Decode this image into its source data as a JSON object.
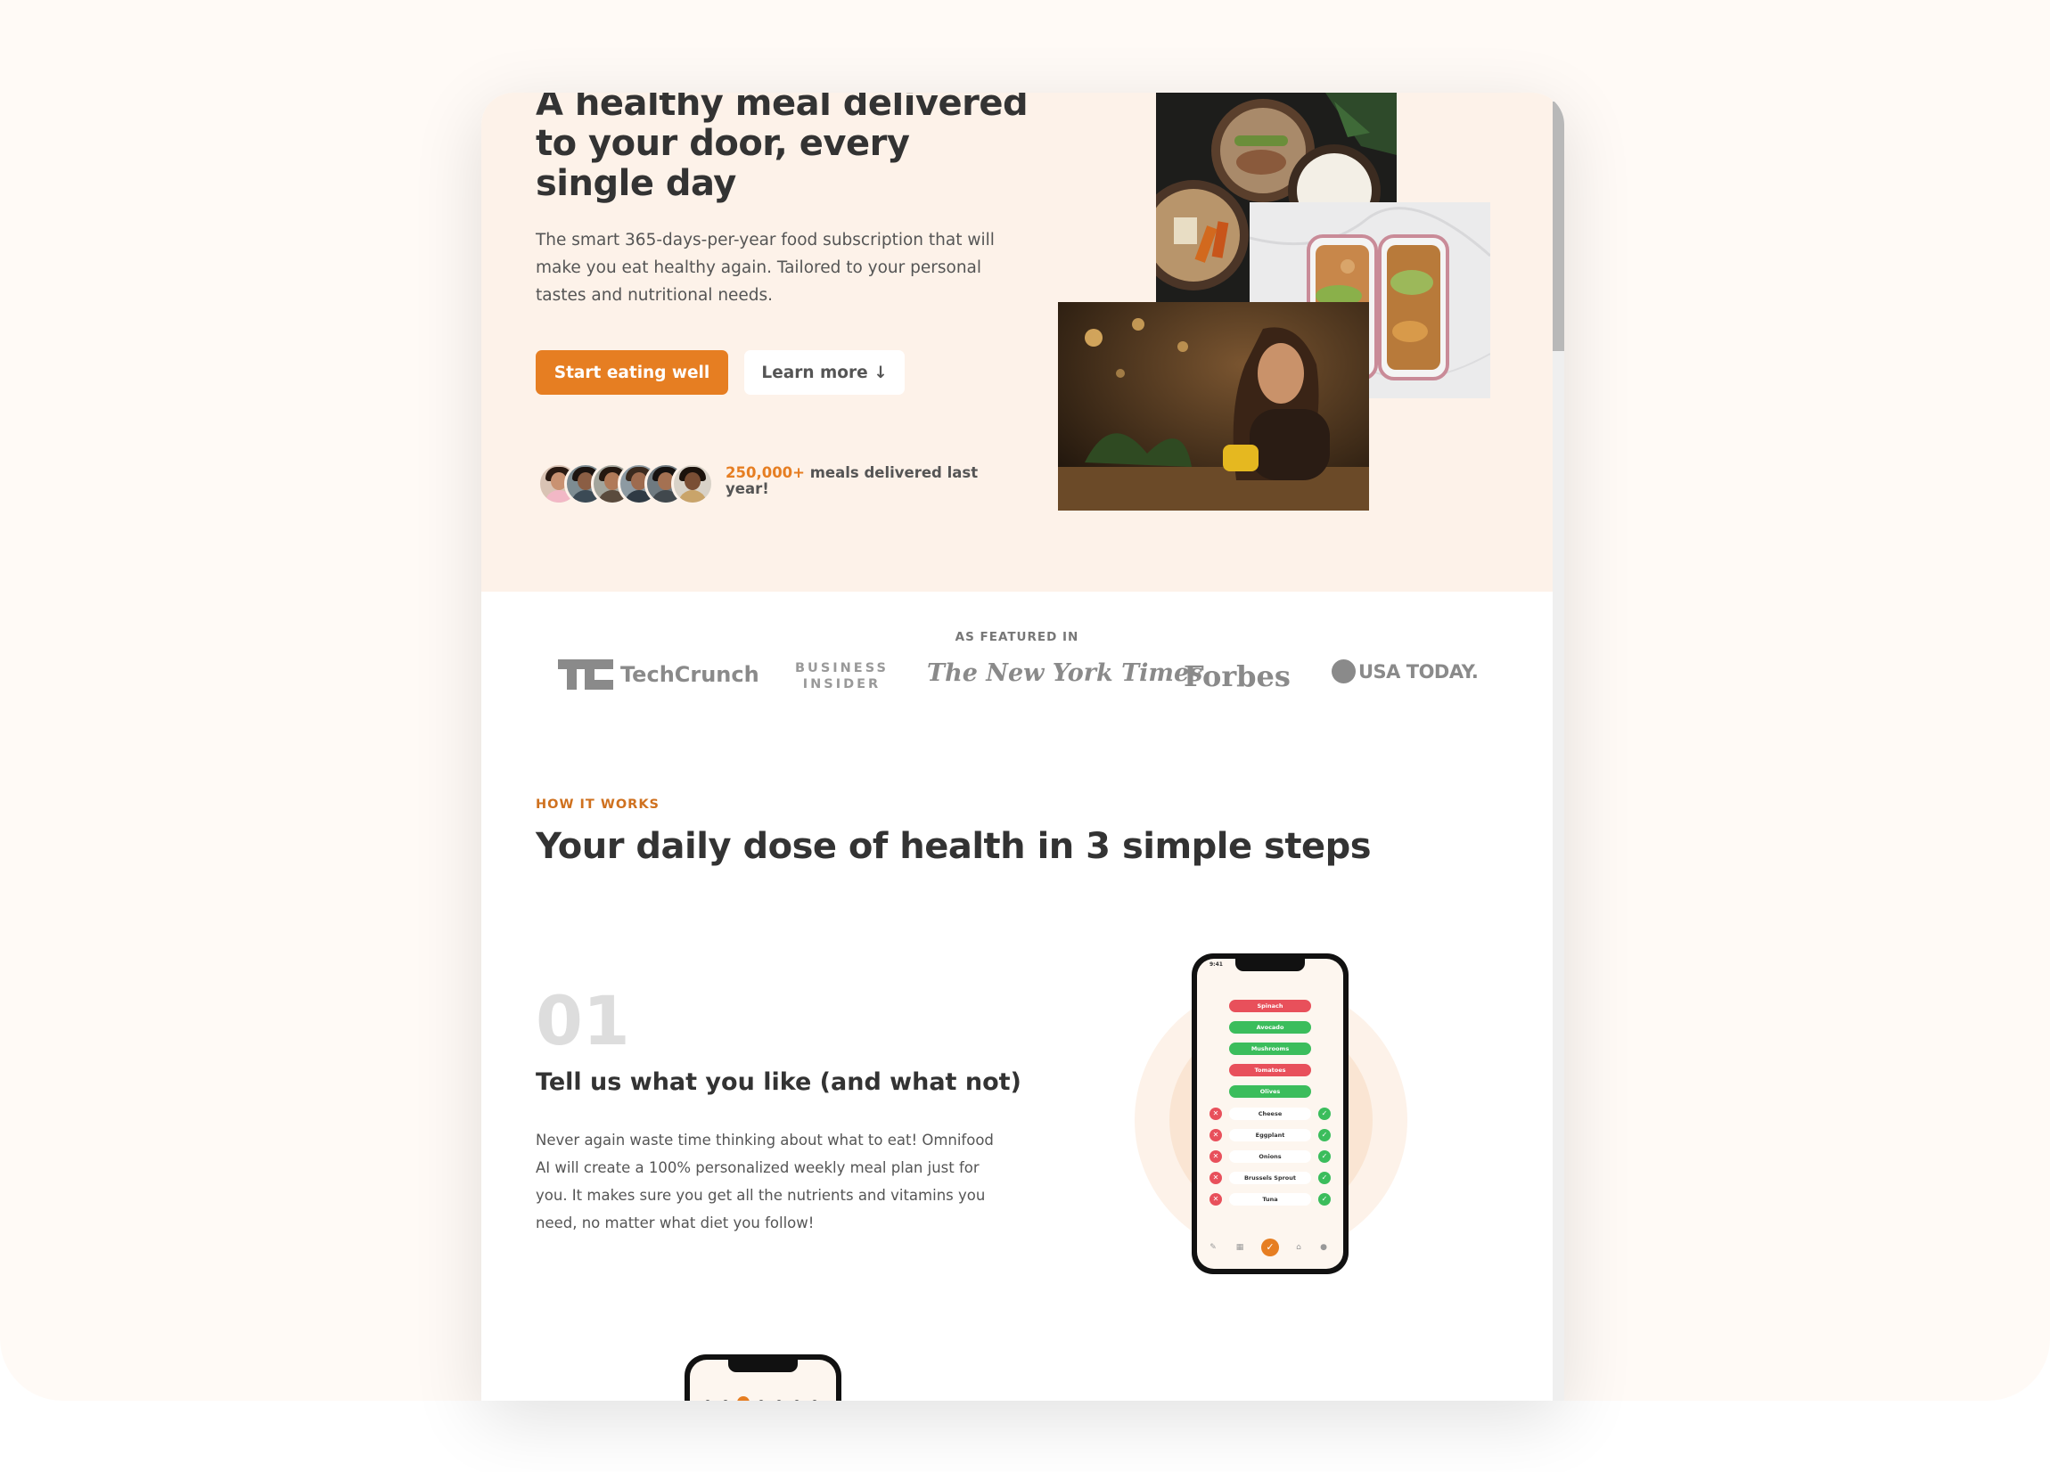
{
  "hero": {
    "title": "A healthy meal delivered to your door, every single day",
    "description": "The smart 365-days-per-year food subscription that will make you eat healthy again. Tailored to your personal tastes and nutritional needs.",
    "cta_primary": "Start eating well",
    "cta_secondary": "Learn more ↓",
    "delivered_count": "250,000+",
    "delivered_text": " meals delivered last year!"
  },
  "featured": {
    "label": "AS FEATURED IN",
    "logos": {
      "techcrunch": "TechCrunch",
      "business_insider_1": "BUSINESS",
      "business_insider_2": "INSIDER",
      "nyt": "The New York Times",
      "forbes": "Forbes",
      "usatoday": "USA TODAY."
    }
  },
  "how_it_works": {
    "subheading": "HOW IT WORKS",
    "title": "Your daily dose of health in 3 simple steps",
    "steps": [
      {
        "number": "01",
        "title": "Tell us what you like (and what not)",
        "description": "Never again waste time thinking about what to eat! Omnifood AI will create a 100% personalized weekly meal plan just for you. It makes sure you get all the nutrients and vitamins you need, no matter what diet you follow!"
      }
    ]
  },
  "phone": {
    "time": "9:41",
    "pills": [
      {
        "label": "Spinach",
        "state": "dislike"
      },
      {
        "label": "Avocado",
        "state": "like"
      },
      {
        "label": "Mushrooms",
        "state": "like"
      },
      {
        "label": "Tomatoes",
        "state": "dislike"
      },
      {
        "label": "Olives",
        "state": "like"
      }
    ],
    "items": [
      "Cheese",
      "Eggplant",
      "Onions",
      "Brussels Sprout",
      "Tuna"
    ]
  },
  "colors": {
    "accent": "#e67e22",
    "hero_bg": "#fdf2e9",
    "like": "#3bbd5c",
    "dislike": "#e8505b"
  }
}
